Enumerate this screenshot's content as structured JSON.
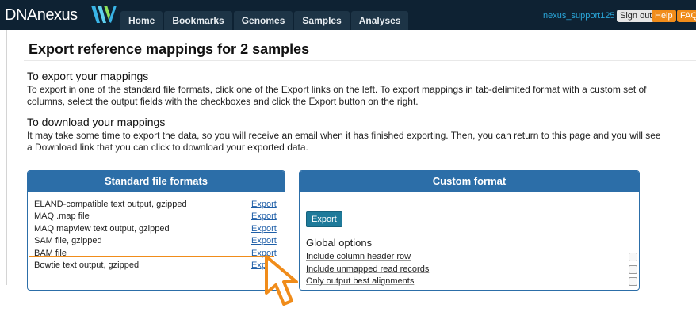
{
  "header": {
    "logo_text": "DNAnexus",
    "tabs": [
      "Home",
      "Bookmarks",
      "Genomes",
      "Samples",
      "Analyses"
    ],
    "username": "nexus_support125",
    "signout_label": "Sign out",
    "help_label": "Help",
    "faq_label": "FAQ"
  },
  "page": {
    "title": "Export reference mappings for 2 samples",
    "export_heading": "To export your mappings",
    "export_text": "To export in one of the standard file formats, click one of the Export links on the left. To export mappings in tab-delimited format with a custom set of columns, select the output fields with the checkboxes and click the Export button on the right.",
    "download_heading": "To download your mappings",
    "download_text": "It may take some time to export the data, so you will receive an email when it has finished exporting. Then, you can return to this page and you will see a Download link that you can click to download your exported data."
  },
  "standard": {
    "title": "Standard file formats",
    "formats": [
      {
        "label": "ELAND-compatible text output, gzipped",
        "link": "Export"
      },
      {
        "label": "MAQ .map file",
        "link": "Export"
      },
      {
        "label": "MAQ mapview text output, gzipped",
        "link": "Export"
      },
      {
        "label": "SAM file, gzipped",
        "link": "Export"
      },
      {
        "label": "BAM file",
        "link": "Export"
      },
      {
        "label": "Bowtie text output, gzipped",
        "link": "Exp"
      }
    ]
  },
  "custom": {
    "title": "Custom format",
    "export_label": "Export",
    "options_heading": "Global options",
    "options": [
      {
        "label": "Include column header row",
        "checked": false
      },
      {
        "label": "Include unmapped read records",
        "checked": false
      },
      {
        "label": "Only output best alignments",
        "checked": false
      }
    ]
  },
  "colors": {
    "topbar": "#0e2233",
    "panel_header": "#2c6ea8",
    "accent_orange": "#f08c1a",
    "link": "#1f5fa8",
    "export_button": "#1e7a9a"
  }
}
